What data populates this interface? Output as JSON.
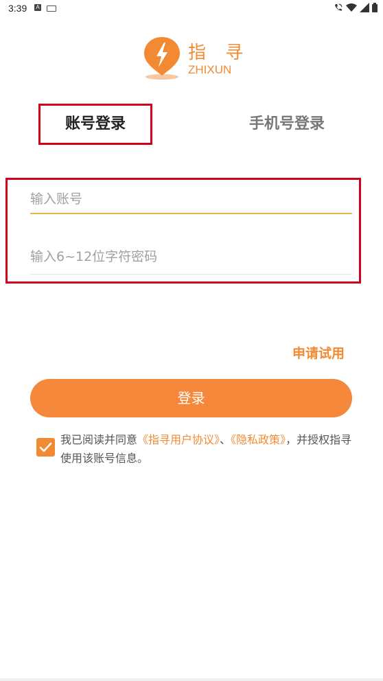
{
  "status_bar": {
    "time": "3:39",
    "left_icons": [
      "a-notification-icon",
      "keyboard-icon"
    ],
    "right_icons": [
      "wifi-calling-icon",
      "wifi-icon",
      "signal-icon",
      "battery-icon"
    ]
  },
  "logo": {
    "name_cn": "指 寻",
    "name_en": "ZHIXUN",
    "icon": "lightning-pin-icon",
    "color": "#f28a33"
  },
  "tabs": [
    {
      "label": "账号登录",
      "active": true
    },
    {
      "label": "手机号登录",
      "active": false
    }
  ],
  "form": {
    "account_placeholder": "输入账号",
    "password_placeholder": "输入6~12位字符密码"
  },
  "apply_trial": "申请试用",
  "login_button": "登录",
  "agreement": {
    "checked": true,
    "prefix": "我已阅读并同意",
    "user_agreement": "《指寻用户协议》",
    "separator": "、",
    "privacy_policy": "《隐私政策》",
    "suffix": "，并授权指寻使用该账号信息。"
  },
  "colors": {
    "accent": "#f28a33",
    "highlight_border": "#d0021b",
    "input_underline_active": "#e8b64a"
  }
}
